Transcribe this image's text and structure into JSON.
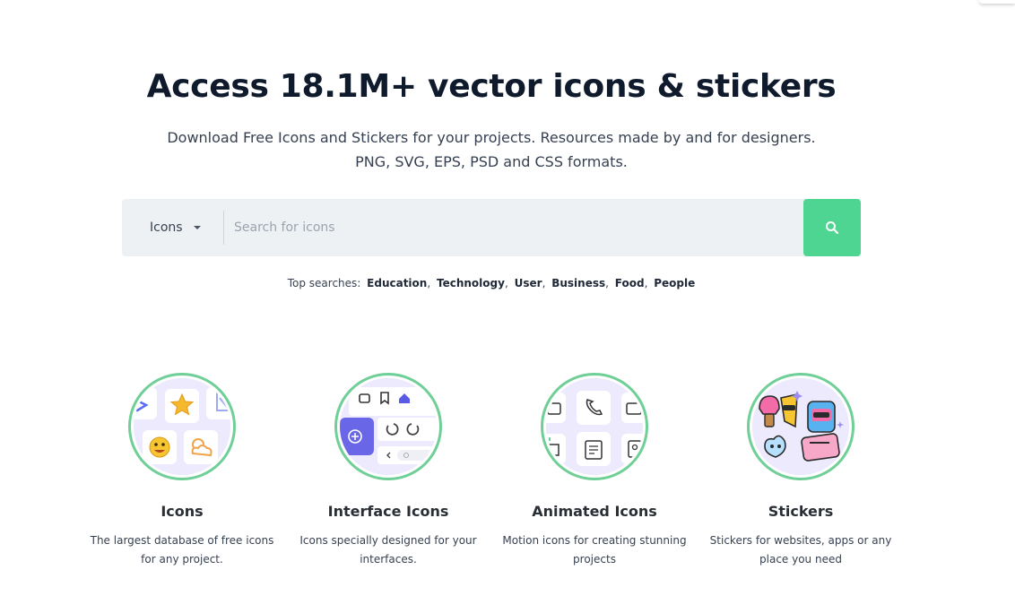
{
  "hero": {
    "title": "Access 18.1M+ vector icons & stickers",
    "subtitle_line1": "Download Free Icons and Stickers for your projects. Resources made by and for designers.",
    "subtitle_line2": "PNG, SVG, EPS, PSD and CSS formats."
  },
  "search": {
    "type_label": "Icons",
    "placeholder": "Search for icons",
    "button_icon": "search-icon",
    "button_color": "#4fd592"
  },
  "top_searches": {
    "label": "Top searches:",
    "items": [
      "Education",
      "Technology",
      "User",
      "Business",
      "Food",
      "People"
    ]
  },
  "categories": [
    {
      "title": "Icons",
      "desc_line1": "The largest database of free icons",
      "desc_line2": "for any project."
    },
    {
      "title": "Interface Icons",
      "desc_line1": "Icons specially designed for your",
      "desc_line2": "interfaces."
    },
    {
      "title": "Animated Icons",
      "desc_line1": "Motion icons for creating stunning",
      "desc_line2": "projects"
    },
    {
      "title": "Stickers",
      "desc_line1": "Stickers for websites, apps or any",
      "desc_line2": "place you need"
    }
  ],
  "colors": {
    "accent": "#4fd592",
    "ring": "#6fcf97",
    "tile_bg": "#eceafc",
    "title": "#0f1b2d"
  }
}
